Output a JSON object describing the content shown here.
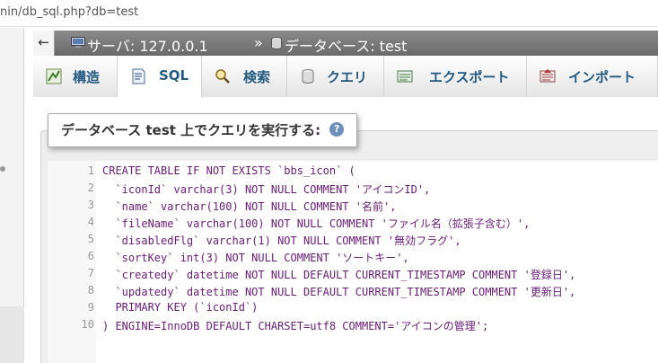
{
  "browser": {
    "url_partial": "nin/db_sql.php?db=test"
  },
  "breadcrumb": {
    "back_glyph": "←",
    "server": "サーバ: 127.0.0.1",
    "separator": "»",
    "database": "データベース: test"
  },
  "tabs": [
    {
      "label": "構造",
      "icon": "structure-icon"
    },
    {
      "label": "SQL",
      "icon": "sql-icon",
      "active": true
    },
    {
      "label": "検索",
      "icon": "search-icon"
    },
    {
      "label": "クエリ",
      "icon": "query-icon"
    },
    {
      "label": "エクスポート",
      "icon": "export-icon"
    },
    {
      "label": "インポート",
      "icon": "import-icon"
    }
  ],
  "query_panel": {
    "legend": "データベース test 上でクエリを実行する:",
    "help_glyph": "?"
  },
  "editor": {
    "line_numbers": [
      "1",
      "2",
      "3",
      "4",
      "5",
      "6",
      "7",
      "8",
      "9",
      "10"
    ],
    "lines": [
      "CREATE TABLE IF NOT EXISTS `bbs_icon` (",
      "  `iconId` varchar(3) NOT NULL COMMENT 'アイコンID',",
      "  `name` varchar(100) NOT NULL COMMENT '名前',",
      "  `fileName` varchar(100) NOT NULL COMMENT 'ファイル名（拡張子含む）',",
      "  `disabledFlg` varchar(1) NOT NULL COMMENT '無効フラグ',",
      "  `sortKey` int(3) NOT NULL COMMENT 'ソートキー',",
      "  `createdy` datetime NOT NULL DEFAULT CURRENT_TIMESTAMP COMMENT '登録日',",
      "  `updatedy` datetime NOT NULL DEFAULT CURRENT_TIMESTAMP COMMENT '更新日',",
      "  PRIMARY KEY (`iconId`)",
      ") ENGINE=InnoDB DEFAULT CHARSET=utf8 COMMENT='アイコンの管理';"
    ]
  },
  "colors": {
    "keyword": "#6a1c78",
    "tab_text": "#235a81",
    "breadcrumb_bg": "#7a7a7a"
  }
}
